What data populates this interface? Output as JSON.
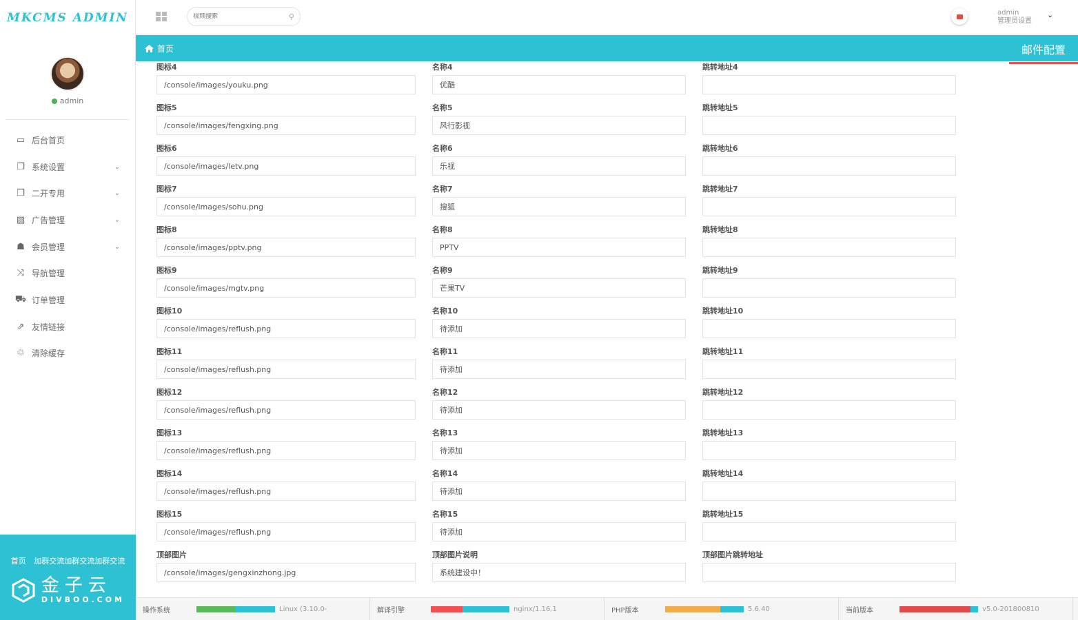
{
  "app": {
    "logo": "MKCMS ADMIN"
  },
  "user": {
    "name": "admin",
    "status_label": "admin",
    "settings_label": "管理员设置"
  },
  "search": {
    "placeholder": "视频搜索"
  },
  "sidebar": {
    "items": [
      {
        "label": "后台首页",
        "icon": "laptop-icon",
        "glyph": "▭",
        "expandable": false
      },
      {
        "label": "系统设置",
        "icon": "copy-icon",
        "glyph": "❐",
        "expandable": true
      },
      {
        "label": "二开专用",
        "icon": "copy-icon",
        "glyph": "❐",
        "expandable": true
      },
      {
        "label": "广告管理",
        "icon": "image-icon",
        "glyph": "▨",
        "expandable": true
      },
      {
        "label": "会员管理",
        "icon": "users-icon",
        "glyph": "☗",
        "expandable": true
      },
      {
        "label": "导航管理",
        "icon": "shuffle-icon",
        "glyph": "⤨",
        "expandable": false
      },
      {
        "label": "订单管理",
        "icon": "cart-icon",
        "glyph": "⛟",
        "expandable": false
      },
      {
        "label": "友情链接",
        "icon": "external-link-icon",
        "glyph": "⇗",
        "expandable": false
      },
      {
        "label": "清除缓存",
        "icon": "trash-icon",
        "glyph": "♲",
        "expandable": false
      }
    ],
    "bottom_links": [
      "首页",
      "加群交流加群交流加群交流"
    ],
    "brand_cn": "金子云",
    "brand_en": "DIVBOO.COM"
  },
  "breadcrumb": {
    "home": "首页",
    "active_tab": "邮件配置"
  },
  "form": {
    "rows": [
      {
        "icon_label": "图标4",
        "icon_value": "/console/images/youku.png",
        "name_label": "名称4",
        "name_value": "优酷",
        "url_label": "跳转地址4",
        "url_value": ""
      },
      {
        "icon_label": "图标5",
        "icon_value": "/console/images/fengxing.png",
        "name_label": "名称5",
        "name_value": "风行影视",
        "url_label": "跳转地址5",
        "url_value": ""
      },
      {
        "icon_label": "图标6",
        "icon_value": "/console/images/letv.png",
        "name_label": "名称6",
        "name_value": "乐视",
        "url_label": "跳转地址6",
        "url_value": ""
      },
      {
        "icon_label": "图标7",
        "icon_value": "/console/images/sohu.png",
        "name_label": "名称7",
        "name_value": "搜狐",
        "url_label": "跳转地址7",
        "url_value": ""
      },
      {
        "icon_label": "图标8",
        "icon_value": "/console/images/pptv.png",
        "name_label": "名称8",
        "name_value": "PPTV",
        "url_label": "跳转地址8",
        "url_value": ""
      },
      {
        "icon_label": "图标9",
        "icon_value": "/console/images/mgtv.png",
        "name_label": "名称9",
        "name_value": "芒果TV",
        "url_label": "跳转地址9",
        "url_value": ""
      },
      {
        "icon_label": "图标10",
        "icon_value": "/console/images/reflush.png",
        "name_label": "名称10",
        "name_value": "待添加",
        "url_label": "跳转地址10",
        "url_value": ""
      },
      {
        "icon_label": "图标11",
        "icon_value": "/console/images/reflush.png",
        "name_label": "名称11",
        "name_value": "待添加",
        "url_label": "跳转地址11",
        "url_value": ""
      },
      {
        "icon_label": "图标12",
        "icon_value": "/console/images/reflush.png",
        "name_label": "名称12",
        "name_value": "待添加",
        "url_label": "跳转地址12",
        "url_value": ""
      },
      {
        "icon_label": "图标13",
        "icon_value": "/console/images/reflush.png",
        "name_label": "名称13",
        "name_value": "待添加",
        "url_label": "跳转地址13",
        "url_value": ""
      },
      {
        "icon_label": "图标14",
        "icon_value": "/console/images/reflush.png",
        "name_label": "名称14",
        "name_value": "待添加",
        "url_label": "跳转地址14",
        "url_value": ""
      },
      {
        "icon_label": "图标15",
        "icon_value": "/console/images/reflush.png",
        "name_label": "名称15",
        "name_value": "待添加",
        "url_label": "跳转地址15",
        "url_value": ""
      },
      {
        "icon_label": "顶部图片",
        "icon_value": "/console/images/gengxinzhong.jpg",
        "name_label": "顶部图片说明",
        "name_value": "系统建设中！",
        "url_label": "顶部图片跳转地址",
        "url_value": ""
      }
    ]
  },
  "footer": {
    "stats": [
      {
        "label": "操作系统",
        "value": "Linux (3.10.0-",
        "fill_fraction": 0.5,
        "fill_color": "#5cb85c"
      },
      {
        "label": "解译引擎",
        "value": "nginx/1.16.1",
        "fill_fraction": 0.4,
        "fill_color": "#f05050"
      },
      {
        "label": "PHP版本",
        "value": "5.6.40",
        "fill_fraction": 0.7,
        "fill_color": "#f0ad4e"
      },
      {
        "label": "当前版本",
        "value": "v5.0-201800810",
        "fill_fraction": 0.9,
        "fill_color": "#e04a4a"
      }
    ]
  },
  "colors": {
    "accent": "#2ec1d3",
    "active_underline": "#f05050",
    "online": "#4caf50",
    "mail": "#e74c3c"
  }
}
